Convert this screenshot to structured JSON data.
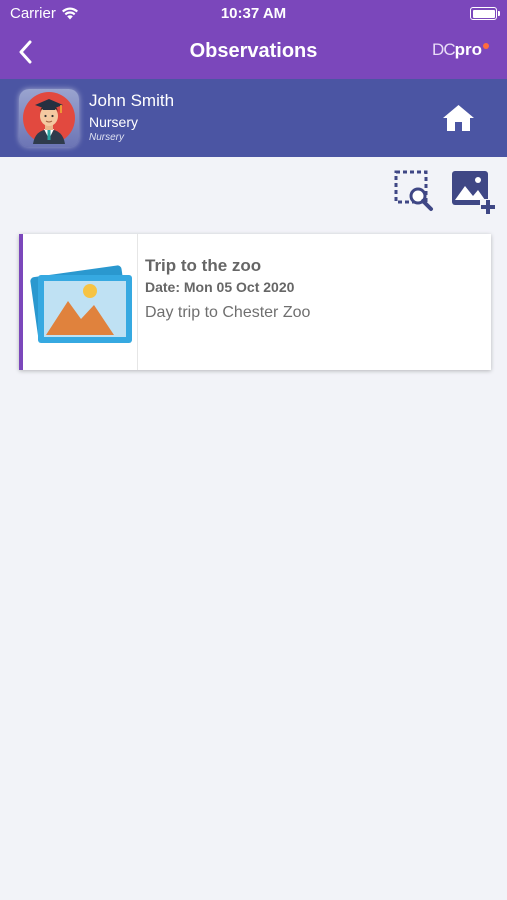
{
  "status_bar": {
    "carrier": "Carrier",
    "time": "10:37 AM"
  },
  "nav": {
    "title": "Observations",
    "logo_dc": "DC",
    "logo_pro": "pro"
  },
  "profile": {
    "name": "John Smith",
    "room": "Nursery",
    "subtitle": "Nursery"
  },
  "toolbar": {
    "icons": [
      "search-selection-icon",
      "add-photo-icon"
    ]
  },
  "observations": [
    {
      "title": "Trip to the zoo",
      "date": "Date: Mon 05 Oct 2020",
      "description": "Day trip to Chester Zoo"
    }
  ],
  "colors": {
    "header": "#7b47bb",
    "profile_bar": "#4b55a3",
    "background": "#f2f3f8",
    "accent": "#7b47bb",
    "icon": "#3f4785"
  }
}
